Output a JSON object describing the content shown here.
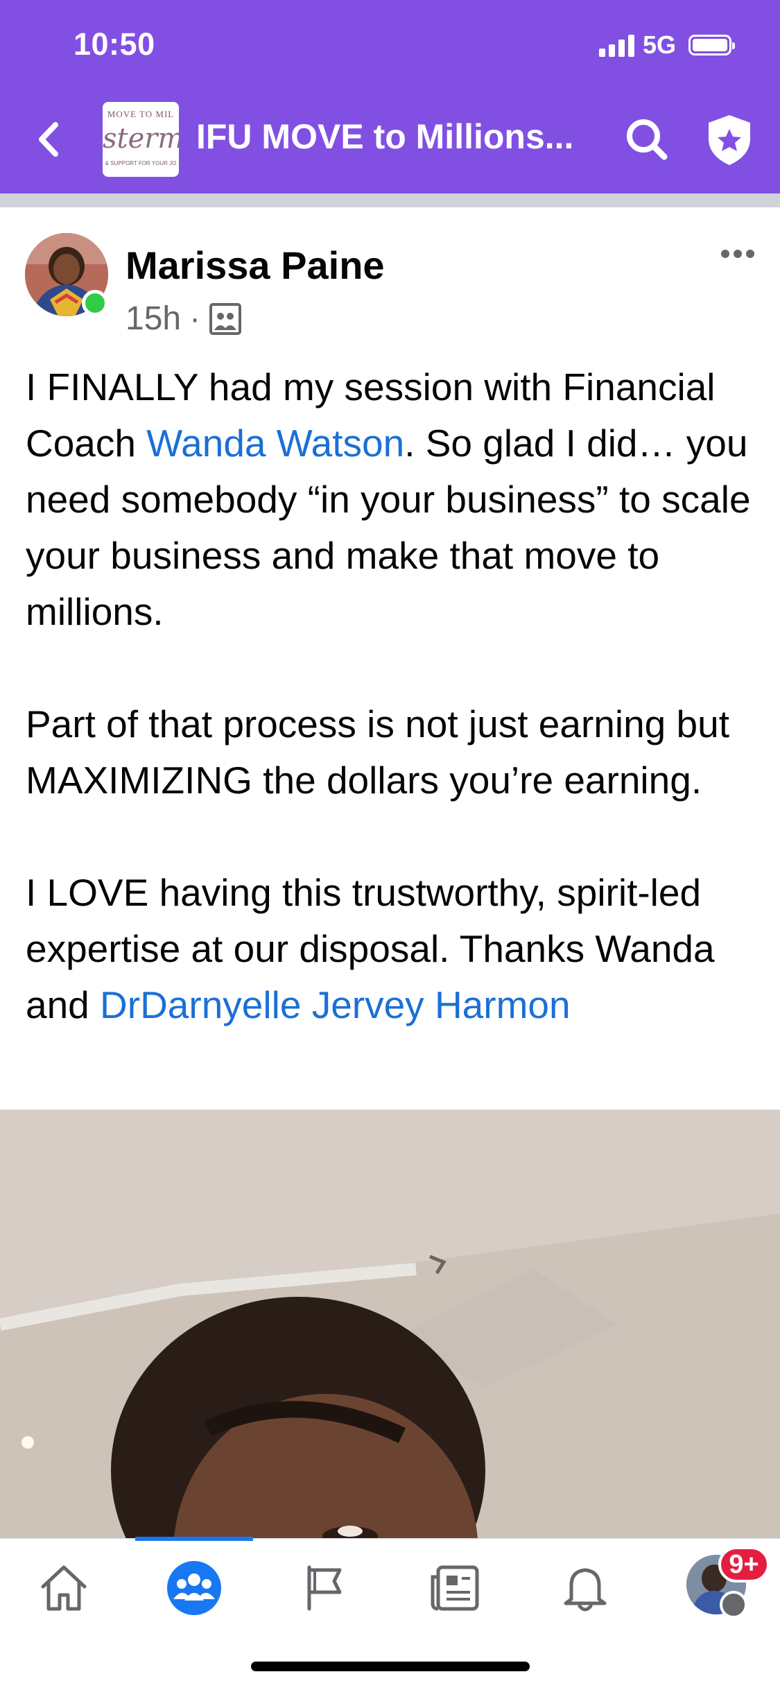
{
  "status": {
    "time": "10:50",
    "network": "5G"
  },
  "header": {
    "group_title": "IFU MOVE to Millions...",
    "logo": {
      "top_text": "MOVE TO MIL",
      "mid_text": "sterm",
      "bottom_text": "& SUPPORT FOR YOUR JO"
    }
  },
  "post": {
    "author": "Marissa Paine",
    "time": "15h",
    "separator": "·",
    "paragraphs": [
      {
        "before": "I FINALLY had my session with Financial Coach ",
        "link": "Wanda Watson",
        "after": ". So glad I did… you need somebody “in your business” to scale your business and make that move to millions."
      },
      {
        "text": "Part of that process is not just earning but MAXIMIZING the dollars you’re earning."
      },
      {
        "before": "I LOVE having this trustworthy, spirit-led expertise at our disposal. Thanks Wanda and ",
        "link": "DrDarnyelle Jervey Harmon"
      }
    ]
  },
  "tabbar": {
    "tabs": [
      "home",
      "groups",
      "pages",
      "news",
      "notifications",
      "menu"
    ],
    "active_tab": "groups",
    "menu_badge": "9+"
  },
  "colors": {
    "header_bg": "#8150e3",
    "link": "#1b6fd6",
    "active_tab": "#1877f2",
    "badge": "#e41e3f",
    "online": "#31cc46"
  }
}
